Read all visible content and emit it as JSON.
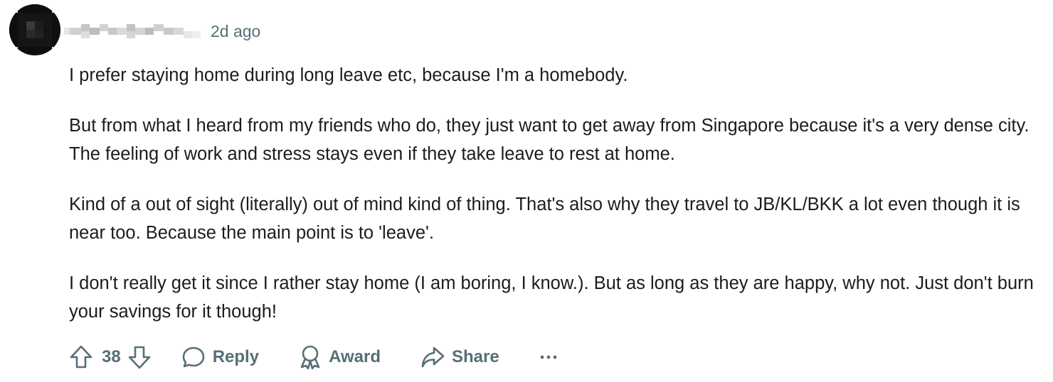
{
  "comment": {
    "timestamp": "2d ago",
    "paragraphs": [
      "I prefer staying home during long leave etc, because I'm a homebody.",
      "But from what I heard from my friends who do, they just want to get away from Singapore because it's a very dense city. The feeling of work and stress stays even if they take leave to rest at home.",
      "Kind of a out of sight (literally) out of mind kind of thing. That's also why they travel to JB/KL/BKK a lot even though it is near too. Because the main point is to 'leave'.",
      "I don't really get it since I rather stay home (I am boring, I know.). But as long as they are happy, why not. Just don't burn your savings for it though!"
    ]
  },
  "actions": {
    "upvote_icon": "arrow-up-outline-icon",
    "vote_count": "38",
    "downvote_icon": "arrow-down-outline-icon",
    "reply_icon": "speech-bubble-icon",
    "reply_label": "Reply",
    "award_icon": "award-ribbon-icon",
    "award_label": "Award",
    "share_icon": "share-arrow-icon",
    "share_label": "Share",
    "more_icon": "ellipsis-icon"
  },
  "colors": {
    "text": "#1c1c1c",
    "meta": "#576f76",
    "background": "#ffffff"
  }
}
